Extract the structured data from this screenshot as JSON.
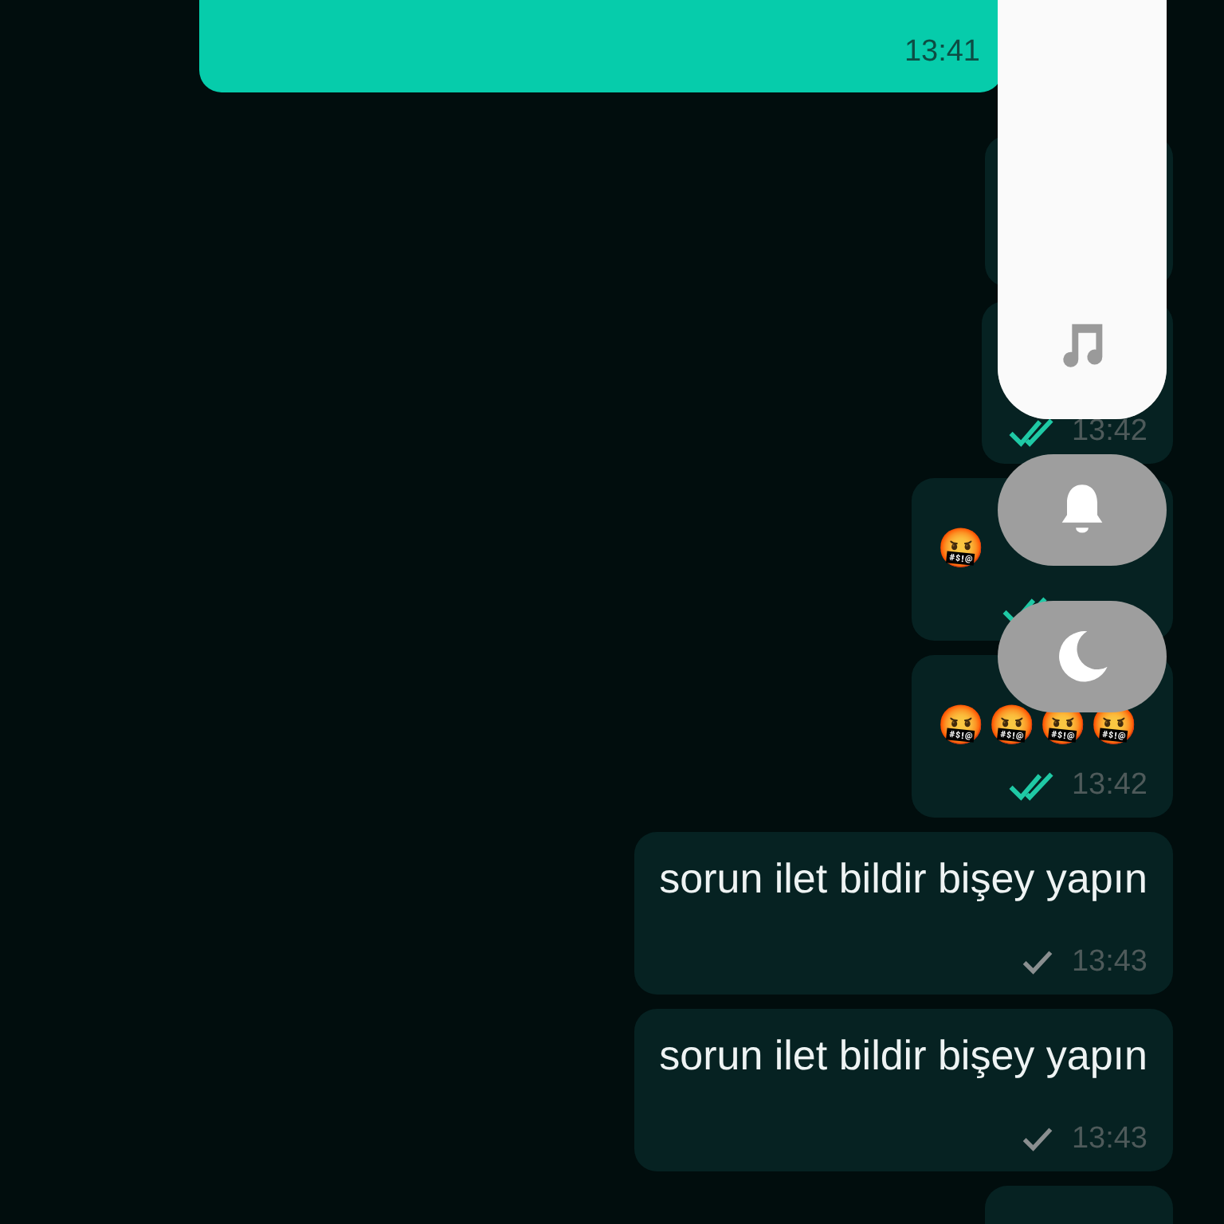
{
  "messages": [
    {
      "kind": "incoming",
      "time": "13:41"
    },
    {
      "kind": "outgoing"
    },
    {
      "kind": "outgoing",
      "time": "13:42",
      "read": true
    },
    {
      "kind": "outgoing",
      "emoji": "🤬",
      "read": true
    },
    {
      "kind": "outgoing",
      "emoji": "🤬🤬🤬🤬",
      "time": "13:42",
      "read": true
    },
    {
      "kind": "outgoing",
      "text": "sorun ilet bildir bişey yapın",
      "time": "13:43",
      "read": false
    },
    {
      "kind": "outgoing",
      "text": "sorun ilet bildir bişey yapın",
      "time": "13:43",
      "read": false
    },
    {
      "kind": "outgoing"
    }
  ],
  "volume_panel": {
    "level": 1,
    "buttons": [
      {
        "kind": "bell"
      },
      {
        "kind": "moon"
      }
    ]
  }
}
